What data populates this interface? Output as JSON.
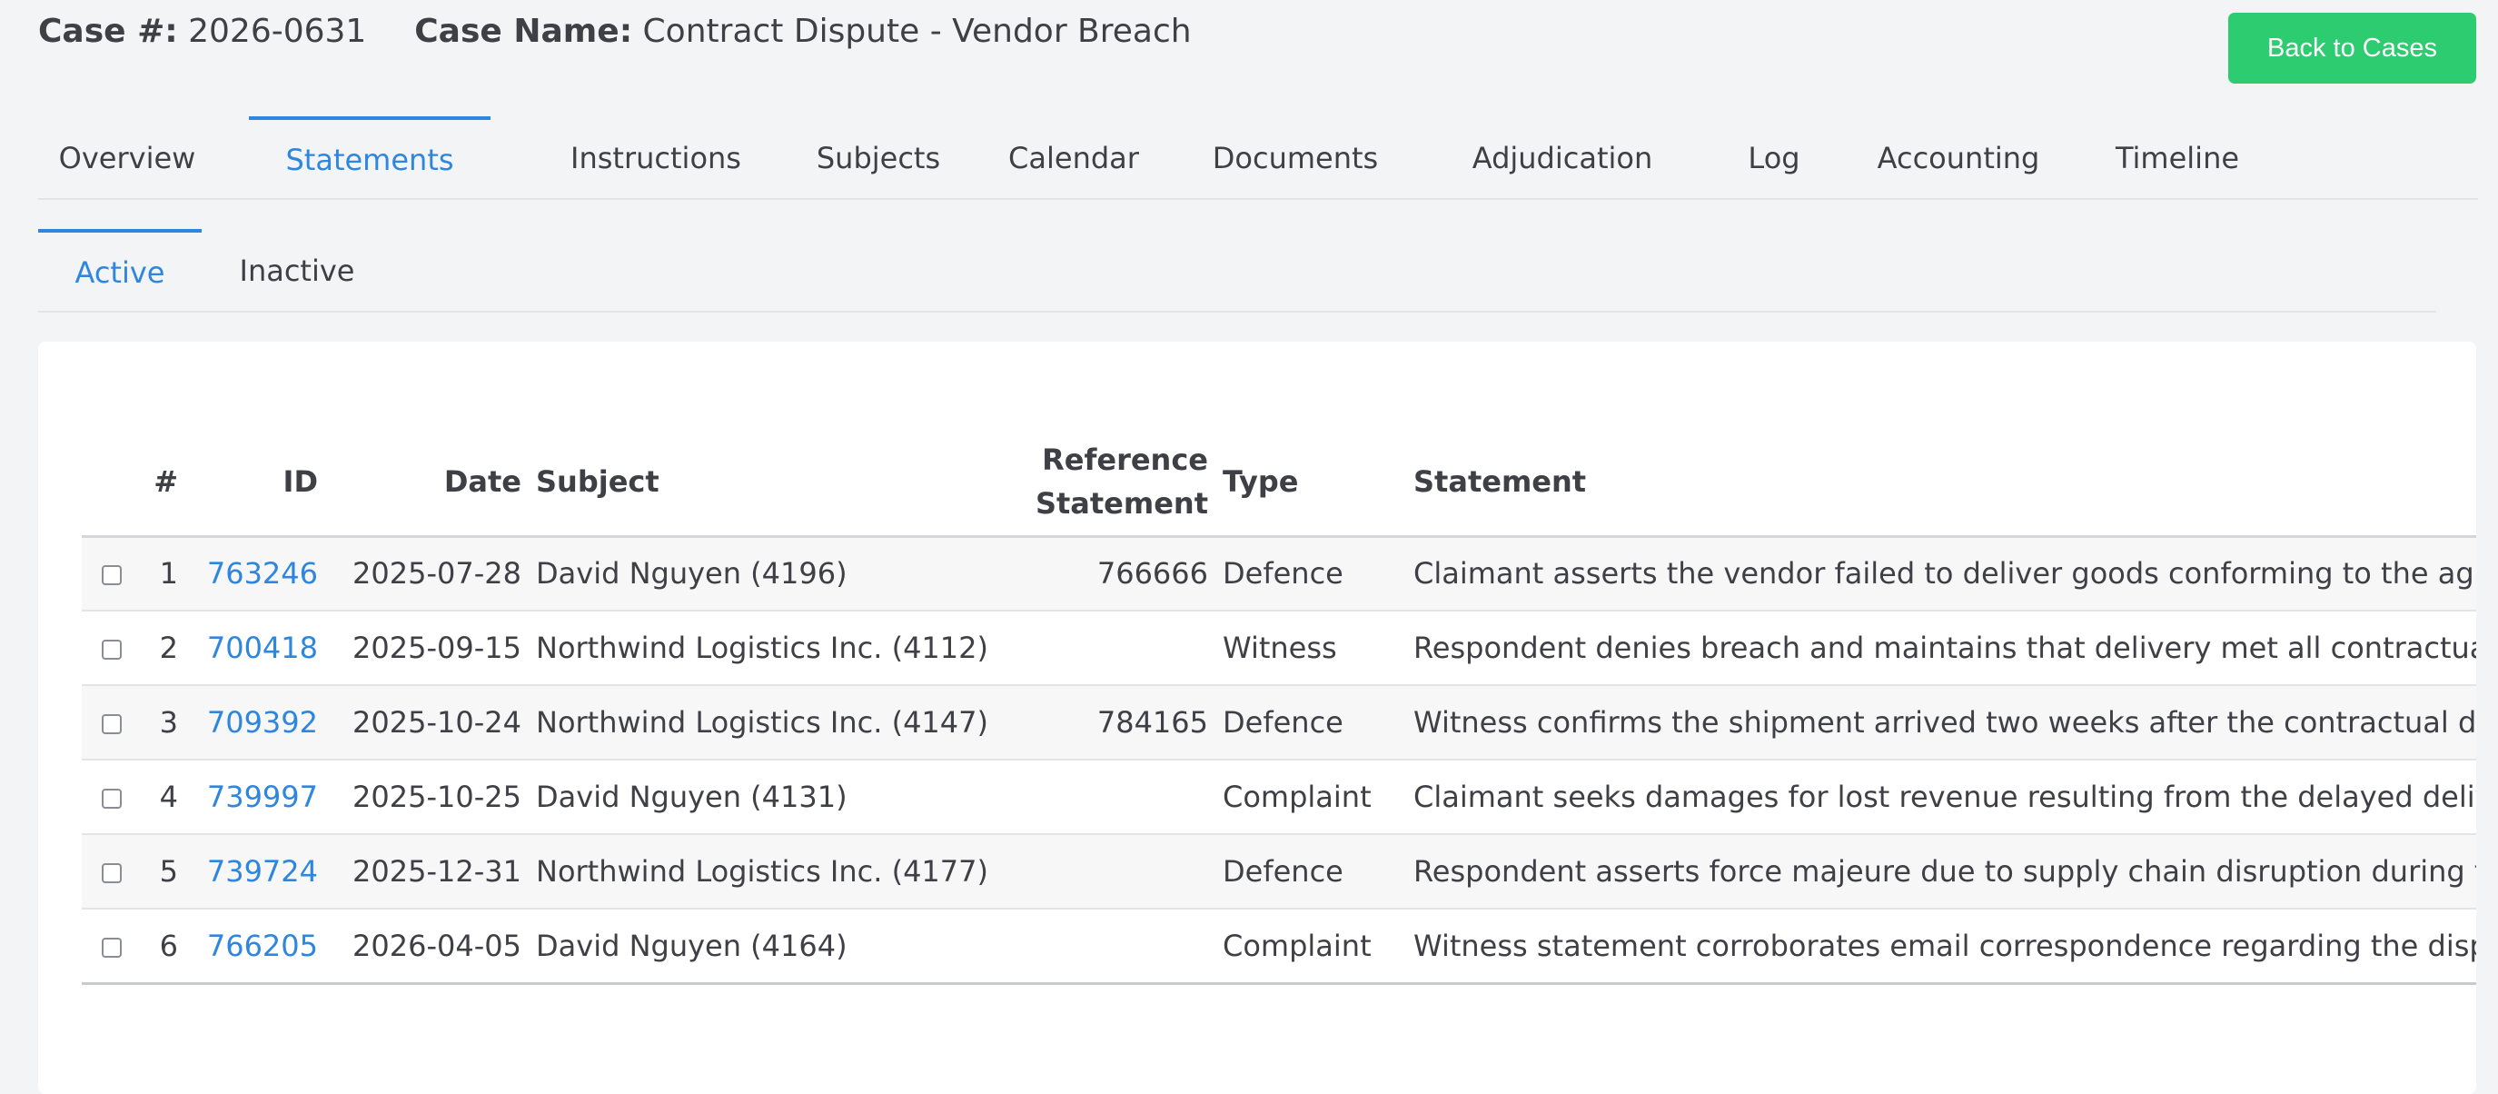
{
  "header": {
    "case_num_label": "Case #:",
    "case_num": "2026-0631",
    "case_name_label": "Case Name:",
    "case_name": "Contract Dispute - Vendor Breach",
    "back_label": "Back to Cases"
  },
  "tabs": [
    {
      "label": "Overview"
    },
    {
      "label": "Statements"
    },
    {
      "label": "Instructions"
    },
    {
      "label": "Subjects"
    },
    {
      "label": "Calendar"
    },
    {
      "label": "Documents"
    },
    {
      "label": "Adjudication"
    },
    {
      "label": "Log"
    },
    {
      "label": "Accounting"
    },
    {
      "label": "Timeline"
    }
  ],
  "active_tab": "Statements",
  "sub_tabs": [
    {
      "label": "Active"
    },
    {
      "label": "Inactive"
    }
  ],
  "active_sub_tab": "Active",
  "table": {
    "columns": {
      "num": "#",
      "id": "ID",
      "date": "Date",
      "subject": "Subject",
      "ref_line1": "Reference",
      "ref_line2": "Statement",
      "type": "Type",
      "statement": "Statement"
    },
    "rows": [
      {
        "num": "1",
        "id": "763246",
        "date": "2025-07-28",
        "subject": "David Nguyen (4196)",
        "ref": "766666",
        "type": "Defence",
        "statement": "Claimant asserts the vendor failed to deliver goods conforming to the agreed specifications"
      },
      {
        "num": "2",
        "id": "700418",
        "date": "2025-09-15",
        "subject": "Northwind Logistics Inc. (4112)",
        "ref": "",
        "type": "Witness",
        "statement": "Respondent denies breach and maintains that delivery met all contractual terms"
      },
      {
        "num": "3",
        "id": "709392",
        "date": "2025-10-24",
        "subject": "Northwind Logistics Inc. (4147)",
        "ref": "784165",
        "type": "Defence",
        "statement": "Witness confirms the shipment arrived two weeks after the contractual deadline"
      },
      {
        "num": "4",
        "id": "739997",
        "date": "2025-10-25",
        "subject": "David Nguyen (4131)",
        "ref": "",
        "type": "Complaint",
        "statement": "Claimant seeks damages for lost revenue resulting from the delayed delivery"
      },
      {
        "num": "5",
        "id": "739724",
        "date": "2025-12-31",
        "subject": "Northwind Logistics Inc. (4177)",
        "ref": "",
        "type": "Defence",
        "statement": "Respondent asserts force majeure due to supply chain disruption during the period"
      },
      {
        "num": "6",
        "id": "766205",
        "date": "2026-04-05",
        "subject": "David Nguyen (4164)",
        "ref": "",
        "type": "Complaint",
        "statement": "Witness statement corroborates email correspondence regarding the dispute"
      }
    ]
  }
}
